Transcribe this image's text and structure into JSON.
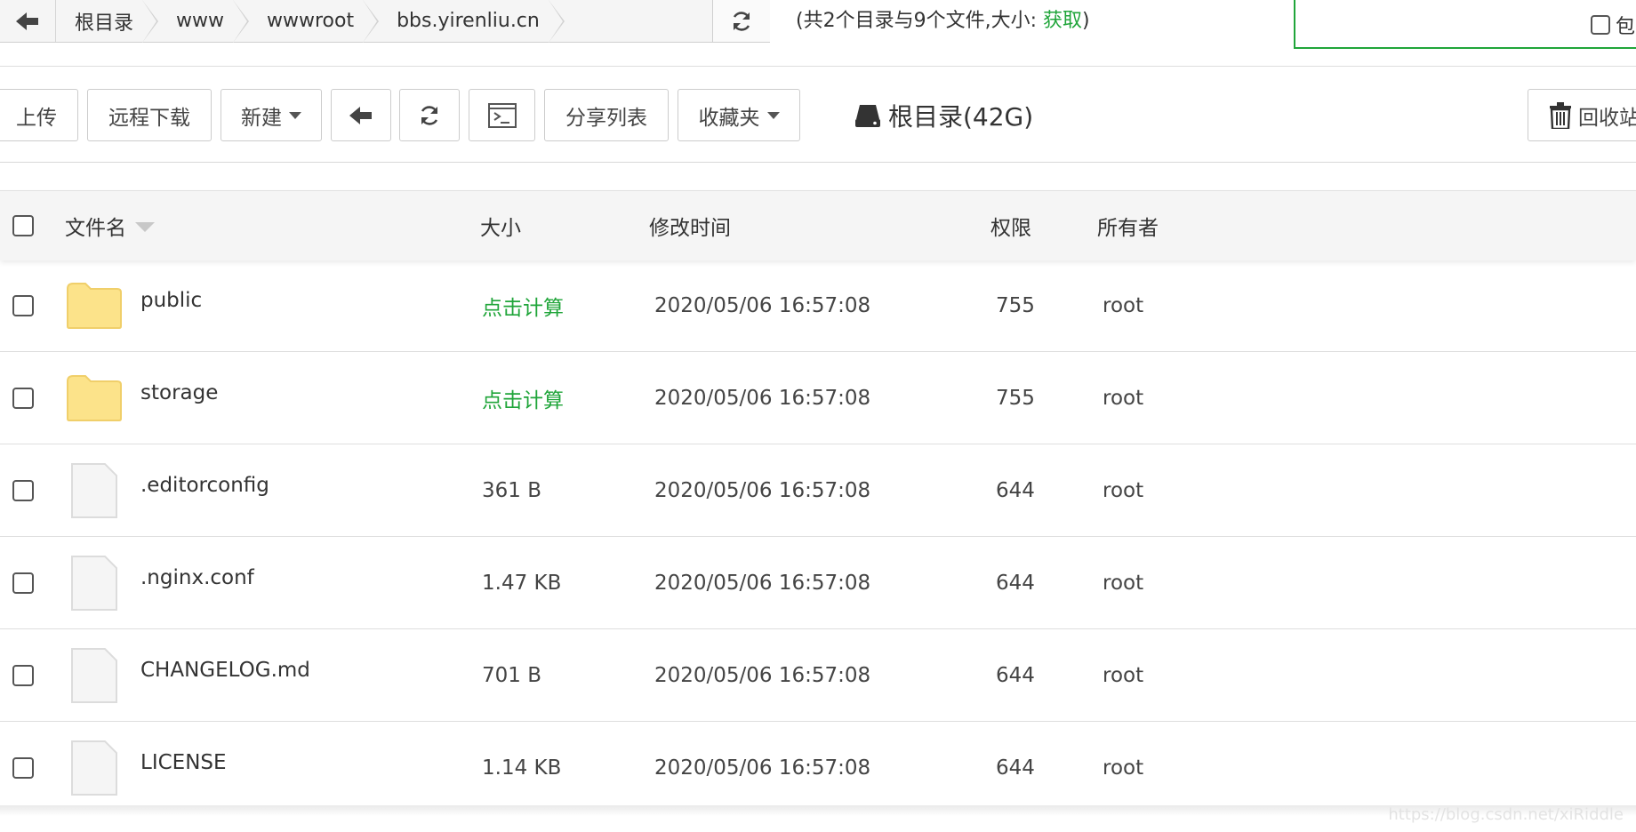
{
  "breadcrumb": {
    "items": [
      "根目录",
      "www",
      "wwwroot",
      "bbs.yirenliu.cn"
    ]
  },
  "summary": {
    "prefix": "(共2个目录与9个文件,大小: ",
    "fetch_label": "获取",
    "suffix": ")"
  },
  "search": {
    "include_subdirs_label": "包"
  },
  "toolbar": {
    "upload": "上传",
    "remote_download": "远程下载",
    "new": "新建",
    "share_list": "分享列表",
    "favorites": "收藏夹",
    "disk_label": "根目录(42G)",
    "recycle_bin": "回收站"
  },
  "table": {
    "headers": {
      "name": "文件名",
      "size": "大小",
      "mtime": "修改时间",
      "perm": "权限",
      "owner": "所有者"
    },
    "rows": [
      {
        "name": "public",
        "type": "folder",
        "size": "点击计算",
        "mtime": "2020/05/06 16:57:08",
        "perm": "755",
        "owner": "root"
      },
      {
        "name": "storage",
        "type": "folder",
        "size": "点击计算",
        "mtime": "2020/05/06 16:57:08",
        "perm": "755",
        "owner": "root"
      },
      {
        "name": ".editorconfig",
        "type": "file",
        "size": "361 B",
        "mtime": "2020/05/06 16:57:08",
        "perm": "644",
        "owner": "root"
      },
      {
        "name": ".nginx.conf",
        "type": "file",
        "size": "1.47 KB",
        "mtime": "2020/05/06 16:57:08",
        "perm": "644",
        "owner": "root"
      },
      {
        "name": "CHANGELOG.md",
        "type": "file",
        "size": "701 B",
        "mtime": "2020/05/06 16:57:08",
        "perm": "644",
        "owner": "root"
      },
      {
        "name": "LICENSE",
        "type": "file",
        "size": "1.14 KB",
        "mtime": "2020/05/06 16:57:08",
        "perm": "644",
        "owner": "root"
      }
    ]
  },
  "watermark": "https://blog.csdn.net/xiRiddle",
  "icons": {
    "back": "arrow-left-icon",
    "refresh": "refresh-icon",
    "terminal": "terminal-icon",
    "disk": "hard-drive-icon",
    "trash": "trash-icon",
    "folder": "folder-icon",
    "file": "file-icon"
  },
  "colors": {
    "accent": "#20a53a",
    "folder": "#fce38a",
    "folder_border": "#f0cf6a",
    "file_fill": "#f5f5f5",
    "file_border": "#dcdcdc"
  }
}
